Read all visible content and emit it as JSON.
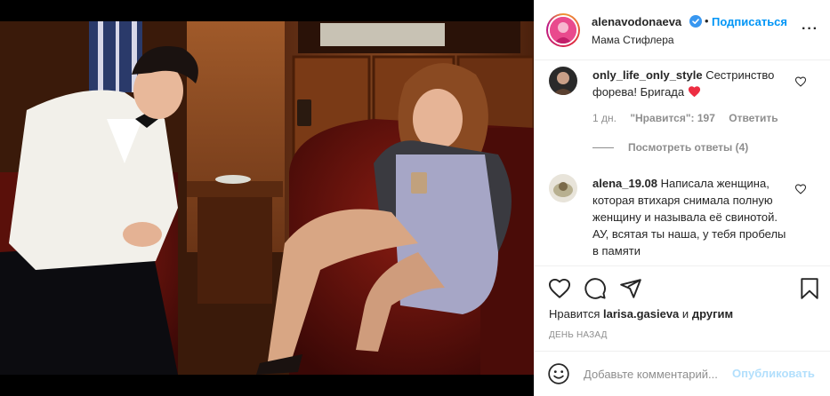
{
  "post": {
    "username": "alenavodonaeva",
    "separator": "•",
    "follow_label": "Подписаться",
    "subtitle": "Мама Стифлера",
    "more_glyph": "···"
  },
  "comments": [
    {
      "username": "only_life_only_style",
      "text": "Сестринство форева! Бригада",
      "time": "1 дн.",
      "likes": "\"Нравится\": 197",
      "reply_label": "Ответить",
      "view_replies": "Посмотреть ответы (4)"
    },
    {
      "username": "alena_19.08",
      "text": "Написала женщина, которая втихаря снимала полную женщину и называла её свинотой. АУ, всятая ты наша, у тебя пробелы в памяти"
    }
  ],
  "actions": {
    "liked_prefix": "Нравится",
    "liked_user": "larisa.gasieva",
    "liked_and": "и",
    "liked_others": "другим",
    "time_ago": "ДЕНЬ НАЗАД"
  },
  "add_comment": {
    "placeholder": "Добавьте комментарий...",
    "publish_label": "Опубликовать"
  },
  "colors": {
    "accent": "#0095f6",
    "heart_red": "#ed4956",
    "muted": "#8e8e8e",
    "publish_disabled": "#b2dffc"
  },
  "icons": [
    "verified-badge-icon",
    "more-options-icon",
    "heart-icon",
    "comment-icon",
    "share-icon",
    "bookmark-icon",
    "emoji-icon",
    "red-heart-emoji"
  ]
}
